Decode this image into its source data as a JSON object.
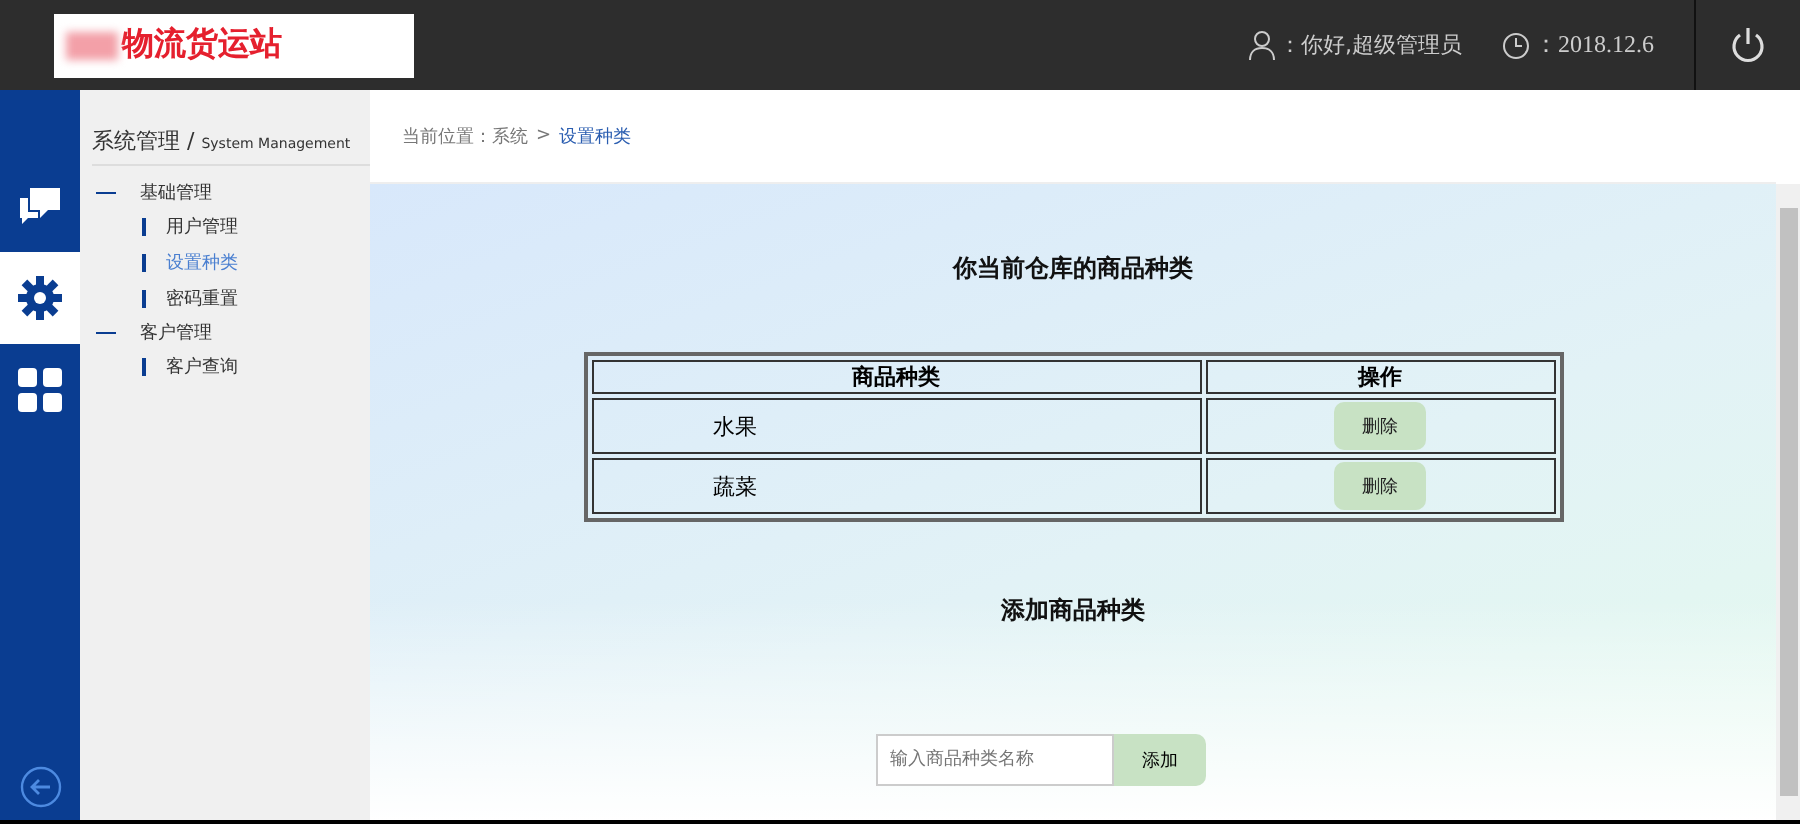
{
  "header": {
    "logo": "物流货运站",
    "greeting": "：你好,超级管理员",
    "date": "：2018.12.6"
  },
  "rail": [
    {
      "kind": "chat",
      "selected": false
    },
    {
      "kind": "gear",
      "selected": true
    },
    {
      "kind": "grid",
      "selected": false
    }
  ],
  "sidebar": {
    "title": "系统管理",
    "title_separator": "/",
    "subtitle": "System Management",
    "groups": [
      {
        "label": "基础管理",
        "children": [
          {
            "label": "用户管理",
            "selected": false
          },
          {
            "label": "设置种类",
            "selected": true
          },
          {
            "label": "密码重置",
            "selected": false
          }
        ]
      },
      {
        "label": "客户管理",
        "children": [
          {
            "label": "客户查询",
            "selected": false
          }
        ]
      }
    ]
  },
  "breadcrumb": {
    "prefix": "当前位置：系统",
    "separator": ">",
    "current": "设置种类"
  },
  "heading": "你当前仓库的商品种类",
  "table": {
    "columns": [
      "商品种类",
      "操作"
    ],
    "rows": [
      {
        "name": "水果",
        "action": "删除"
      },
      {
        "name": "蔬菜",
        "action": "删除"
      }
    ]
  },
  "add_heading": "添加商品种类",
  "add_form": {
    "placeholder": "输入商品种类名称",
    "button": "添加"
  }
}
